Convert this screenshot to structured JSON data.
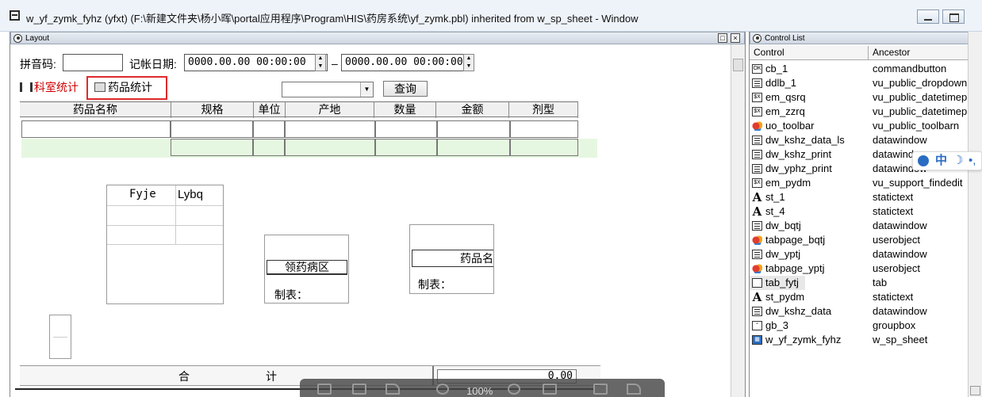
{
  "window": {
    "title": "w_yf_zymk_fyhz (yfxt) (F:\\新建文件夹\\杨小晖\\portal应用程序\\Program\\HIS\\药房系统\\yf_zymk.pbl) inherited from w_sp_sheet - Window"
  },
  "layout_pane": {
    "title": "Layout",
    "pinyin_label": "拼音码:",
    "pinyin_value": "",
    "date_label": "记帐日期:",
    "date_from": "0000.00.00 00:00:00",
    "date_sep": "–",
    "date_to": "0000.00.00 00:00:00",
    "tabs": [
      {
        "label": "科室统计",
        "color": "#d00000"
      },
      {
        "label": "药品统计",
        "color": "#000000"
      }
    ],
    "query_button": "查询",
    "grid": {
      "headers": [
        "药品名称",
        "规格",
        "单位",
        "产地",
        "数量",
        "金额",
        "剂型"
      ]
    },
    "box1": {
      "col1": "Fyje",
      "col2": "Lybq"
    },
    "box2": {
      "title": "领药病区",
      "footer": "制表："
    },
    "box3": {
      "title": "药品名",
      "footer": "制表："
    },
    "footer": {
      "label_left": "合",
      "label_right": "计",
      "total": "0.00"
    }
  },
  "control_list": {
    "title": "Control List",
    "headers": {
      "control": "Control",
      "ancestor": "Ancestor"
    },
    "items": [
      {
        "control": "cb_1",
        "ancestor": "commandbutton",
        "icon": "commandbutton-icon"
      },
      {
        "control": "ddlb_1",
        "ancestor": "vu_public_dropdown",
        "icon": "dropdownlist-icon"
      },
      {
        "control": "em_qsrq",
        "ancestor": "vu_public_datetimepi",
        "icon": "editmask-icon"
      },
      {
        "control": "em_zzrq",
        "ancestor": "vu_public_datetimepi",
        "icon": "editmask-icon"
      },
      {
        "control": "uo_toolbar",
        "ancestor": "vu_public_toolbarn",
        "icon": "userobject-icon"
      },
      {
        "control": "dw_kshz_data_ls",
        "ancestor": "datawindow",
        "icon": "datawindow-icon"
      },
      {
        "control": "dw_kshz_print",
        "ancestor": "datawindow",
        "icon": "datawindow-icon"
      },
      {
        "control": "dw_yphz_print",
        "ancestor": "datawindow",
        "icon": "datawindow-icon"
      },
      {
        "control": "em_pydm",
        "ancestor": "vu_support_findedit",
        "icon": "editmask-icon"
      },
      {
        "control": "st_1",
        "ancestor": "statictext",
        "icon": "statictext-icon"
      },
      {
        "control": "st_4",
        "ancestor": "statictext",
        "icon": "statictext-icon"
      },
      {
        "control": "dw_bqtj",
        "ancestor": "datawindow",
        "icon": "datawindow-icon"
      },
      {
        "control": "tabpage_bqtj",
        "ancestor": "userobject",
        "icon": "userobject-icon"
      },
      {
        "control": "dw_yptj",
        "ancestor": "datawindow",
        "icon": "datawindow-icon"
      },
      {
        "control": "tabpage_yptj",
        "ancestor": "userobject",
        "icon": "userobject-icon"
      },
      {
        "control": "tab_fytj",
        "ancestor": "tab",
        "icon": "tab-icon"
      },
      {
        "control": "st_pydm",
        "ancestor": "statictext",
        "icon": "statictext-icon"
      },
      {
        "control": "dw_kshz_data",
        "ancestor": "datawindow",
        "icon": "datawindow-icon"
      },
      {
        "control": "gb_3",
        "ancestor": "groupbox",
        "icon": "groupbox-icon"
      },
      {
        "control": "w_yf_zymk_fyhz",
        "ancestor": "w_sp_sheet",
        "icon": "window-icon"
      }
    ]
  },
  "ime": {
    "label": "中"
  },
  "float_toolbar": {
    "zoom": "100%"
  }
}
